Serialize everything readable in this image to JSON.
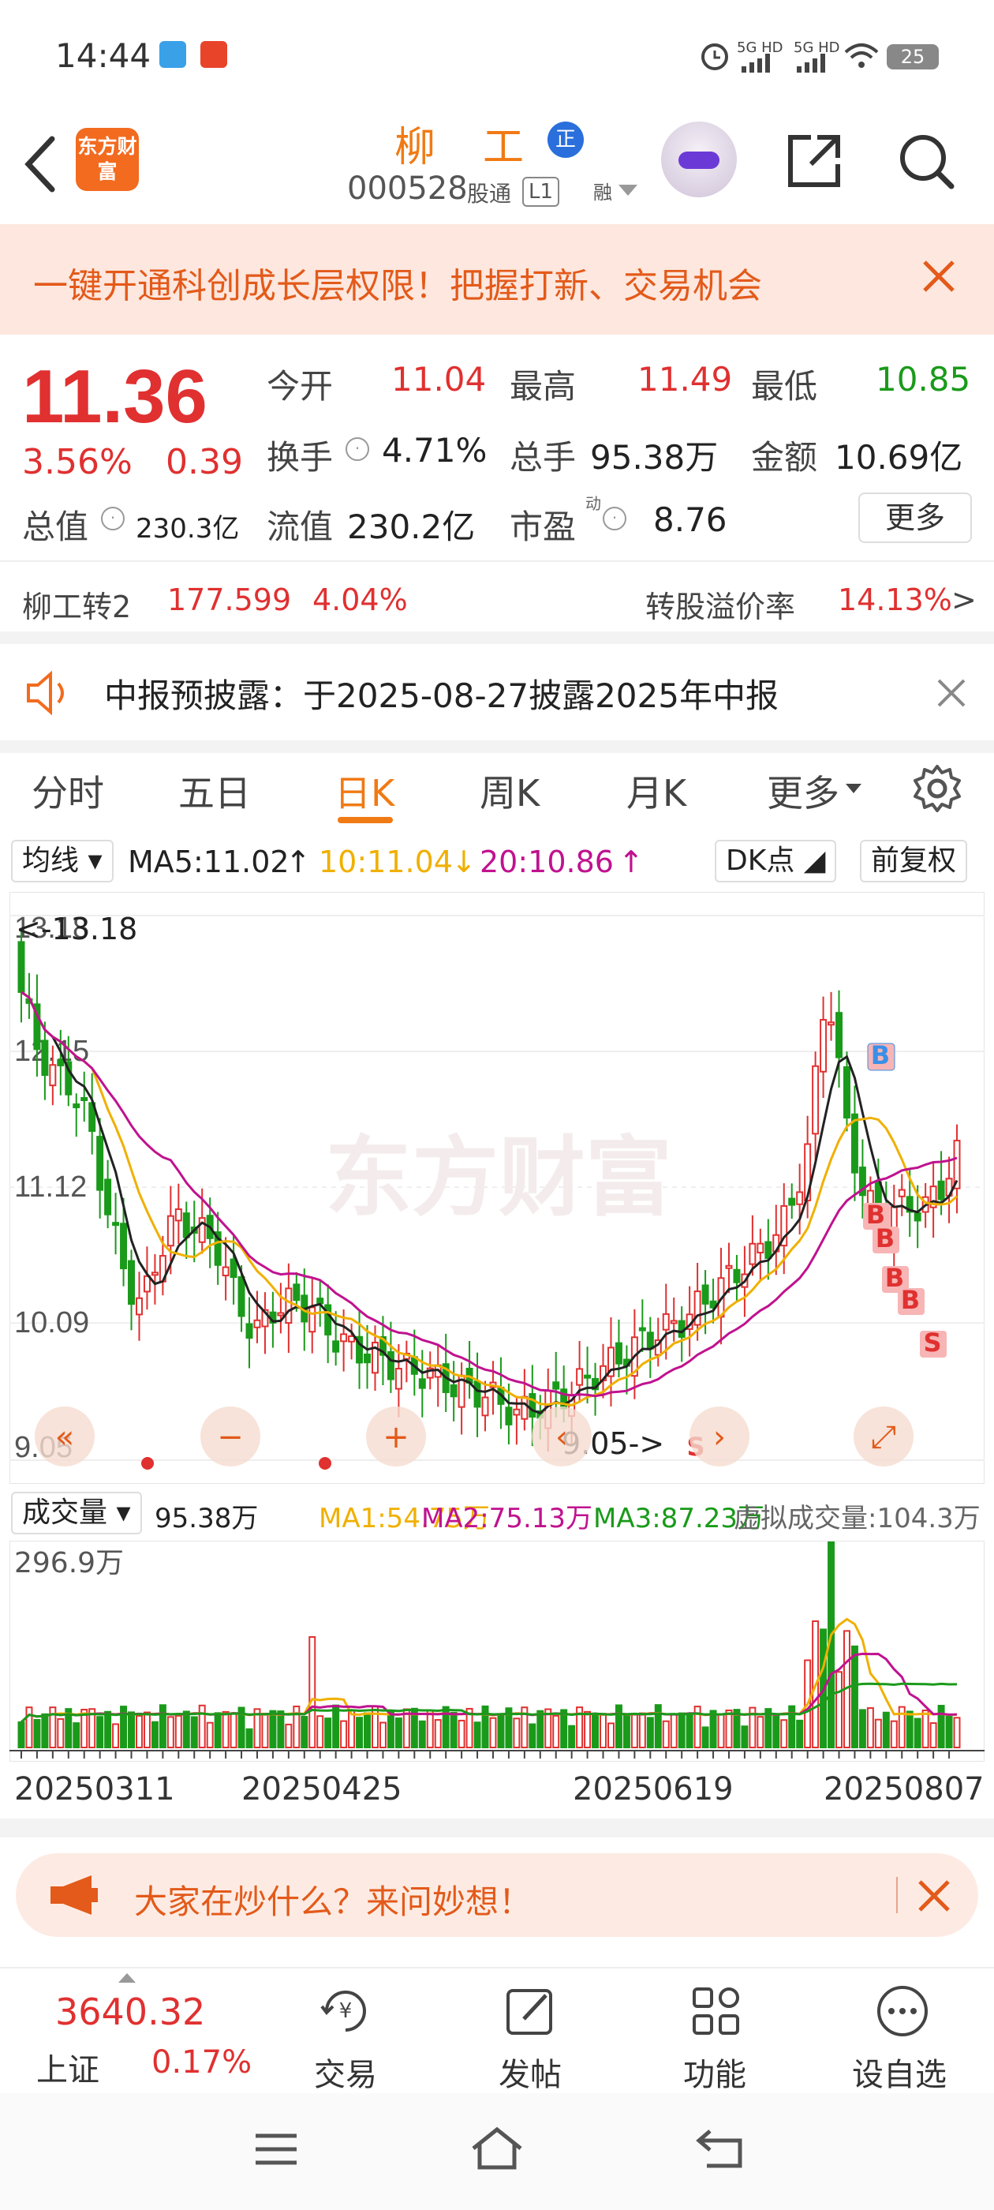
{
  "status_bar": {
    "time": "14:44",
    "network1": "5G HD",
    "network2": "5G HD",
    "battery": "25"
  },
  "header": {
    "brand": "东方财富",
    "stock_name": "柳工",
    "badge": "正",
    "code": "000528",
    "tag1": "股通",
    "tag2": "L1",
    "tag3": "融"
  },
  "banner": {
    "text": "一键开通科创成长层权限！把握打新、交易机会"
  },
  "quote": {
    "price": "11.36",
    "change_pct": "3.56%",
    "change": "0.39",
    "open_label": "今开",
    "open": "11.04",
    "high_label": "最高",
    "high": "11.49",
    "low_label": "最低",
    "low": "10.85",
    "turnover_label": "换手",
    "turnover": "4.71%",
    "volume_label": "总手",
    "volume": "95.38万",
    "amount_label": "金额",
    "amount": "10.69亿",
    "mktcap_label": "总值",
    "mktcap": "230.3亿",
    "float_label": "流值",
    "float": "230.2亿",
    "pe_label": "市盈",
    "pe_sup": "动",
    "pe": "8.76",
    "more": "更多"
  },
  "bond": {
    "name": "柳工转2",
    "price": "177.599",
    "pct": "4.04%",
    "premium_label": "转股溢价率",
    "premium": "14.13%",
    "arrow": ">"
  },
  "notice": {
    "text": "中报预披露：于2025-08-27披露2025年中报"
  },
  "tabs": [
    "分时",
    "五日",
    "日K",
    "周K",
    "月K",
    "更多"
  ],
  "ma_row": {
    "selector": "均线",
    "ma5": "MA5:11.02",
    "ma10": "10:11.04",
    "ma20": "20:10.86",
    "dk": "DK点",
    "adjust": "前复权"
  },
  "chart_data": {
    "type": "candlestick",
    "y_ticks": [
      "13.18",
      "12.15",
      "11.12",
      "10.09",
      "9.05"
    ],
    "ylim": [
      9.05,
      13.18
    ],
    "max_annotation": "<-13.18",
    "min_annotation": "9.05->",
    "x_labels": [
      "20250311",
      "20250425",
      "20250619",
      "20250807"
    ],
    "watermark": "东方财富",
    "markers": [
      "S",
      "B",
      "B",
      "B",
      "B",
      "B",
      "S"
    ],
    "colors": {
      "up": "#e03030",
      "down": "#1a9a1a",
      "ma5": "#222222",
      "ma10": "#f0b000",
      "ma20": "#c0128f"
    }
  },
  "volume": {
    "selector": "成交量",
    "v": "95.38万",
    "ma1": "MA1:54.75万",
    "ma2": "MA2:75.13万",
    "ma3": "MA3:87.23万",
    "virtual": "虚拟成交量:104.3万",
    "max_label": "296.9万"
  },
  "ask": {
    "text": "大家在炒什么？来问妙想！"
  },
  "bottom_nav": {
    "index_value": "3640.32",
    "index_name": "上证",
    "index_pct": "0.17%",
    "items": [
      "交易",
      "发帖",
      "功能",
      "设自选"
    ]
  }
}
